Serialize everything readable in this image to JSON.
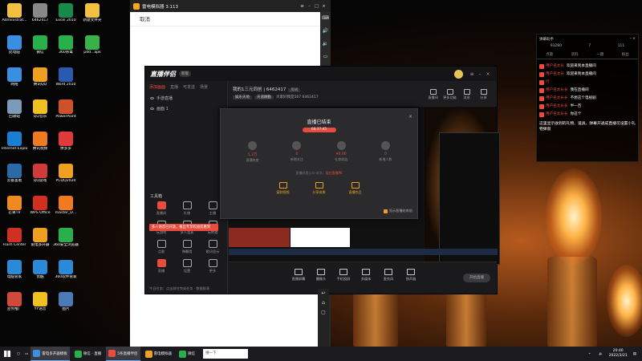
{
  "desktop": {
    "icons": [
      {
        "label": "Administrat...",
        "color": "#f0c040"
      },
      {
        "label": "此电脑",
        "color": "#3a8fe0"
      },
      {
        "label": "网络",
        "color": "#3a8fe0"
      },
      {
        "label": "回收站",
        "color": "#7a9ab8"
      },
      {
        "label": "Internet Explorer",
        "color": "#1a7fd4"
      },
      {
        "label": "云备查看",
        "color": "#2a6aa8"
      },
      {
        "label": "芒果TV",
        "color": "#f08a20"
      },
      {
        "label": "Flash Center",
        "color": "#d03020"
      },
      {
        "label": "电脑管家",
        "color": "#2a8ad8"
      },
      {
        "label": "宣传推广",
        "color": "#d04a3a"
      },
      {
        "label": "6462417",
        "color": "#888888"
      },
      {
        "label": "微信",
        "color": "#2ab04a"
      },
      {
        "label": "腾讯QQ",
        "color": "#f0a020"
      },
      {
        "label": "QQ音乐",
        "color": "#f0c020"
      },
      {
        "label": "腾讯视频",
        "color": "#f07a20"
      },
      {
        "label": "QQ游戏",
        "color": "#d03a3a"
      },
      {
        "label": "WPS Office",
        "color": "#d03020"
      },
      {
        "label": "雷电多开器",
        "color": "#f0a020"
      },
      {
        "label": "优酷",
        "color": "#2a8ad8"
      },
      {
        "label": "YY语音",
        "color": "#f0c020"
      },
      {
        "label": "Excel 2010",
        "color": "#1a8a4a"
      },
      {
        "label": "360杀毒",
        "color": "#2ab04a"
      },
      {
        "label": "Word 2010",
        "color": "#2a5ab0"
      },
      {
        "label": "PowerPoint",
        "color": "#d0502a"
      },
      {
        "label": "拼多多",
        "color": "#e03a3a"
      },
      {
        "label": "PCQQ2020",
        "color": "#f0a020"
      },
      {
        "label": "master_D...",
        "color": "#f07a20"
      },
      {
        "label": "360安全浏览器",
        "color": "#2ab04a"
      },
      {
        "label": "360软件管家",
        "color": "#2a8ad8"
      },
      {
        "label": "图片",
        "color": "#4a7ab8"
      },
      {
        "label": "新建文件夹",
        "color": "#f0c040"
      },
      {
        "label": "pdd...apk",
        "color": "#3ab04a"
      }
    ]
  },
  "emulator": {
    "title": "雷电模拟器 3.113",
    "cancel": "取消",
    "side_icons": [
      "keyboard-icon",
      "volume-up-icon",
      "volume-down-icon",
      "screen-icon",
      "more-icon"
    ],
    "strip_icons": [
      "back-icon",
      "home-icon",
      "recent-icon"
    ]
  },
  "live_app": {
    "brand": "直播伴侣",
    "version": "新版",
    "tabs": [
      "添加画面",
      "直播",
      "可发送",
      "场景"
    ],
    "scenes": [
      "手游直播",
      "画面 1"
    ],
    "room_title": "我的1三元同创 | 6462417",
    "room_badge": "房间",
    "room_tags": [
      "娱乐天地",
      "天道酬勤"
    ],
    "room_meta": "大家好我是567  6462417",
    "right_icons": [
      {
        "label": "直播间"
      },
      {
        "label": "更多功能"
      },
      {
        "label": "消息"
      },
      {
        "label": "分享"
      }
    ],
    "tools_title": "工具箱",
    "tools": [
      {
        "label": "直播间",
        "red": true
      },
      {
        "label": "礼物"
      },
      {
        "label": "主播"
      },
      {
        "label": "玩游戏"
      },
      {
        "label": "多人连麦"
      },
      {
        "label": "玩转道"
      },
      {
        "label": "点歌"
      },
      {
        "label": "弹幕墙"
      },
      {
        "label": "歌词显示"
      },
      {
        "label": "直播",
        "red": true
      },
      {
        "label": "设置"
      },
      {
        "label": "更多"
      }
    ],
    "promo": "多人语音已开放，推出专享权益优惠到",
    "footer": "今日任务：点击前往完成任务 · 数据报表",
    "bottom": [
      "直播屏幕",
      "摄像头",
      "手机投屏",
      "多媒体",
      "麦克风",
      "扬声器"
    ],
    "start": "开始直播"
  },
  "end_dialog": {
    "title": "直播已结束",
    "duration": "00:37:45",
    "stats": [
      {
        "value": "5.2万",
        "label": "直播热度"
      },
      {
        "value": "0",
        "label": "新增关注"
      },
      {
        "value": "¥0.00",
        "label": "礼物收益"
      },
      {
        "value": "0",
        "label": "新增人数"
      }
    ],
    "tip_prefix": "直播间我公众·本次，",
    "tip_link": "现在直播PK",
    "actions": [
      "复制视频",
      "分享成果",
      "直播作品"
    ],
    "keep": "显示直播结束前"
  },
  "danmu": {
    "title": "弹幕助手",
    "counts": [
      "93280",
      "7",
      "111"
    ],
    "tabs": [
      "点歌",
      "资料",
      "一键",
      "粉丝"
    ],
    "messages": [
      {
        "name": "用户名太长",
        "text": "欢迎来到本直播间"
      },
      {
        "name": "用户名太长",
        "text": "欢迎来到本直播间"
      },
      {
        "name": "行",
        "text": ""
      },
      {
        "name": "用户名太长长",
        "text": "我在直播间"
      },
      {
        "name": "用户名太长长",
        "text": "不想这个电视剧"
      },
      {
        "name": "用户名太长长",
        "text": "半一百"
      },
      {
        "name": "用户名太长长",
        "text": "你这个"
      }
    ],
    "notice": "这里显示收到的礼物、道具、弹幕开通成直播可设置小礼物弹窗"
  },
  "taskbar": {
    "search": "搜一下",
    "items": [
      {
        "label": "雷电多开器模板",
        "active": true
      },
      {
        "label": "微信 - 直播",
        "active": false
      },
      {
        "label": "5条直播伴侣",
        "active": true
      },
      {
        "label": "雷电模拟器",
        "active": false
      },
      {
        "label": "微信",
        "active": false
      }
    ],
    "time": "20:40",
    "date": "2022/3/21"
  }
}
